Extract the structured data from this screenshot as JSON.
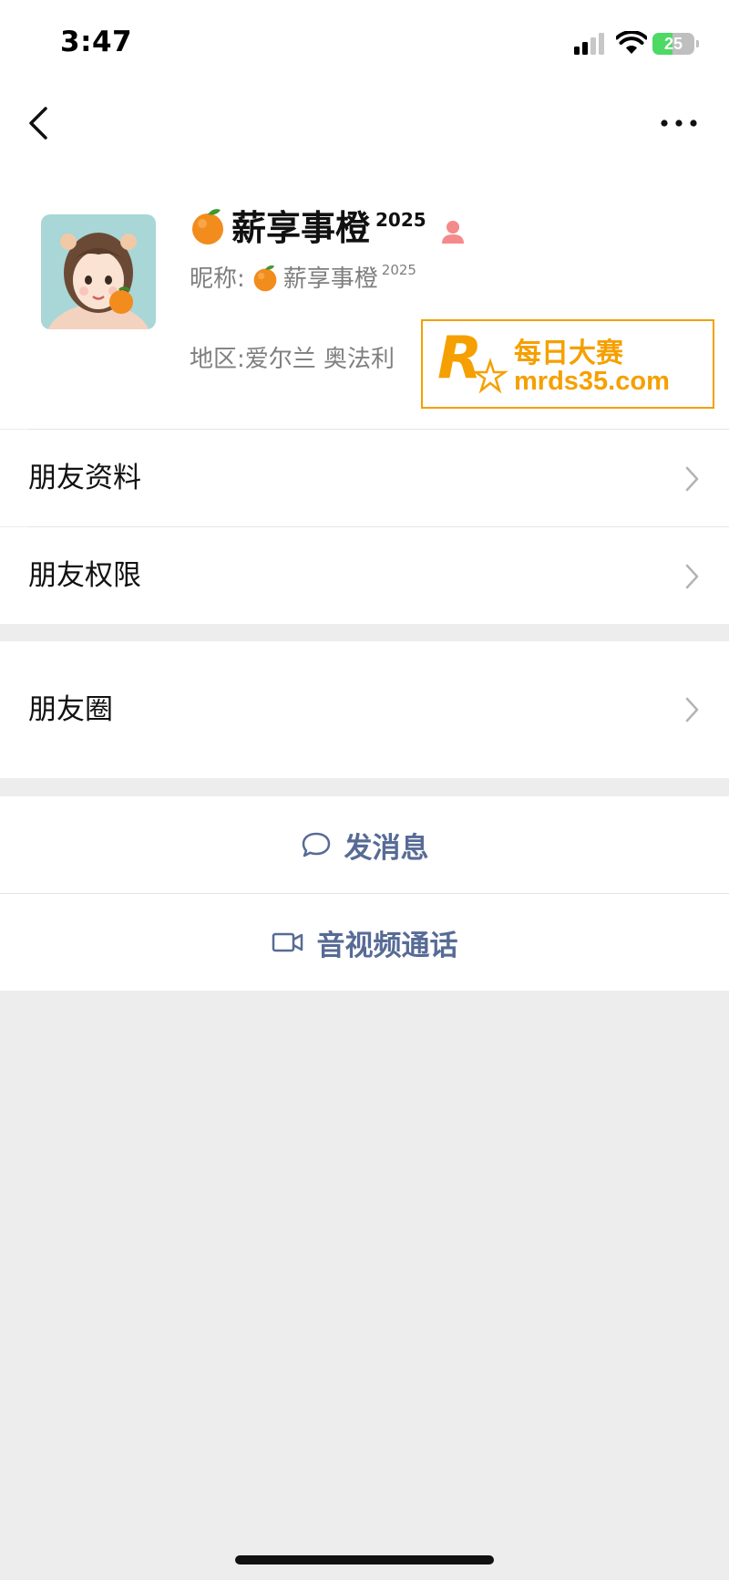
{
  "status_bar": {
    "time": "3:47",
    "battery": "25"
  },
  "profile": {
    "display_name": "薪享事橙",
    "name_suffix": "2025",
    "nickname_label": "昵称:",
    "nickname": "薪享事橙",
    "nickname_suffix": "2025",
    "region_label": "地区:",
    "region": "爱尔兰 奥法利"
  },
  "watermark": {
    "cn": "每日大赛",
    "en": "mrds35.com"
  },
  "menu": {
    "friend_info": "朋友资料",
    "friend_permissions": "朋友权限",
    "moments": "朋友圈"
  },
  "actions": {
    "send_message": "发消息",
    "av_call": "音视频通话"
  },
  "colors": {
    "link_blue": "#576b95",
    "watermark_orange": "#f5a000",
    "background": "#ededed"
  }
}
